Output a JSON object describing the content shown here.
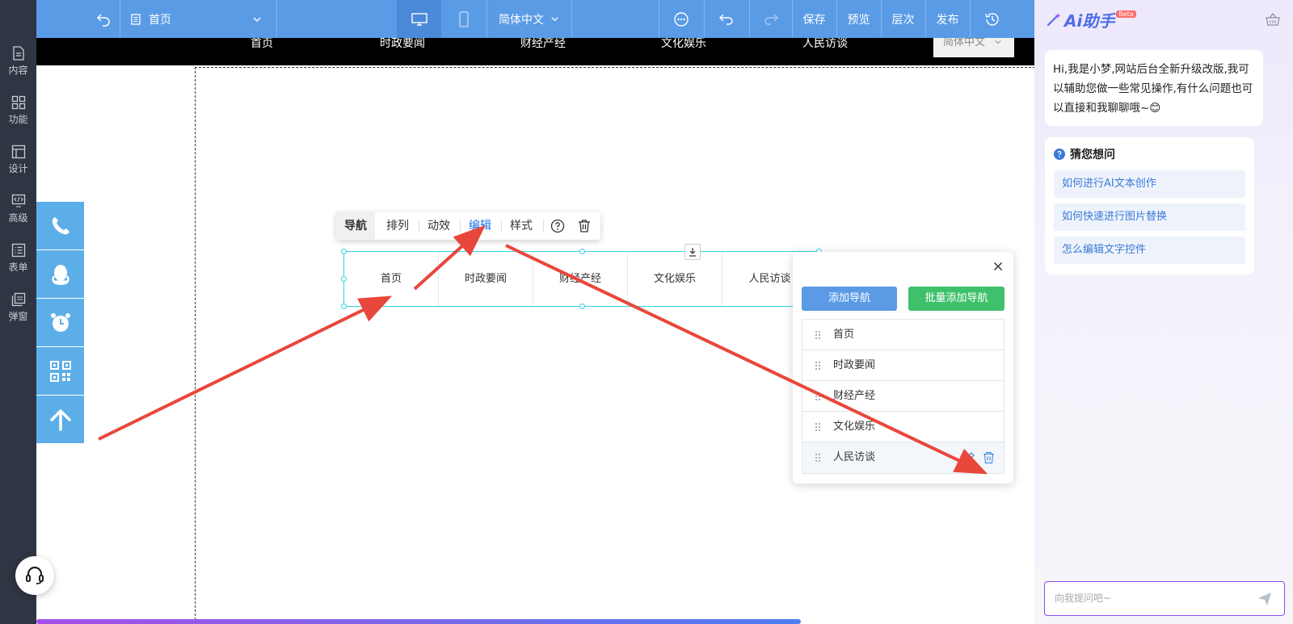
{
  "topbar": {
    "page_name": "首页",
    "language": "简体中文",
    "save": "保存",
    "preview": "预览",
    "layers": "层次",
    "publish": "发布"
  },
  "sidebar": {
    "items": [
      {
        "label": "内容",
        "icon": "document-icon"
      },
      {
        "label": "功能",
        "icon": "grid-icon"
      },
      {
        "label": "设计",
        "icon": "layout-icon"
      },
      {
        "label": "高级",
        "icon": "code-monitor-icon"
      },
      {
        "label": "表单",
        "icon": "form-icon"
      },
      {
        "label": "弹窗",
        "icon": "popup-icon"
      }
    ]
  },
  "site": {
    "nav": [
      "首页",
      "时政要闻",
      "财经产经",
      "文化娱乐",
      "人民访谈"
    ],
    "lang_select": "简体中文"
  },
  "float_bar": [
    "phone-icon",
    "qq-icon",
    "alarm-icon",
    "qrcode-icon",
    "arrow-up-icon"
  ],
  "toolbar": {
    "nav": "导航",
    "arrange": "排列",
    "animation": "动效",
    "edit": "编辑",
    "style": "样式"
  },
  "nav_widget": {
    "items": [
      "首页",
      "时政要闻",
      "财经产经",
      "文化娱乐",
      "人民访谈"
    ]
  },
  "edit_panel": {
    "add_nav": "添加导航",
    "batch_add_nav": "批量添加导航",
    "add_color": "#5b9be6",
    "batch_color": "#3fc06a",
    "items": [
      "首页",
      "时政要闻",
      "财经产经",
      "文化娱乐",
      "人民访谈"
    ]
  },
  "ai": {
    "logo": "Ai助手",
    "beta": "Beta",
    "greeting": "Hi,我是小梦,网站后台全新升级改版,我可以辅助您做一些常见操作,有什么问题也可以直接和我聊聊哦~😊",
    "suggest_title": "猜您想问",
    "suggestions": [
      "如何进行AI文本创作",
      "如何快速进行图片替换",
      "怎么编辑文字控件"
    ],
    "input_placeholder": "向我提问吧~"
  },
  "colors": {
    "topbar": "#5a9be6",
    "sidebar": "#2f3542",
    "float_bar": "#5caee9",
    "annotation_arrow": "#e8473c",
    "accent": "#1a73e8"
  }
}
